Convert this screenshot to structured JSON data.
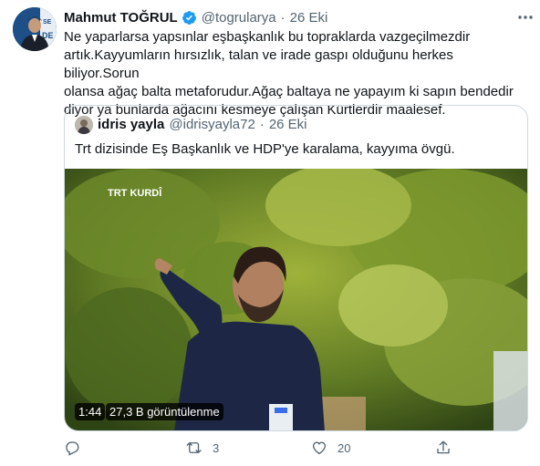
{
  "tweet": {
    "author_name": "Mahmut TOĞRUL",
    "author_handle": "@togrularya",
    "separator": "·",
    "date": "26 Eki",
    "text": "Ne yaparlarsa yapsınlar eşbaşkanlık bu topraklarda vazgeçilmezdir\nartık.Kayyumların hırsızlık, talan ve irade gaspı olduğunu herkes biliyor.Sorun\nolansa ağaç balta metaforudur.Ağaç baltaya ne yapayım ki sapın bendedir\ndiyor ya bunlarda ağacını kesmeye çalışan Kürtlerdir maalesef.",
    "verified_icon": "verified-badge-icon",
    "more_icon": "more-options-icon",
    "accent_color": "#1d9bf0"
  },
  "quoted_tweet": {
    "author_name": "idris yayla",
    "author_handle": "@idrisyayla72",
    "separator": "·",
    "date": "26 Eki",
    "text": "Trt dizisinde Eş Başkanlık ve HDP'ye karalama, kayyıma övgü.",
    "video": {
      "duration": "1:44",
      "views": "27,3 B görüntülenme",
      "channel_logo": "TRT KURDÎ"
    }
  },
  "actions": {
    "reply": {
      "icon": "reply-icon",
      "count": ""
    },
    "retweet": {
      "icon": "retweet-icon",
      "count": "3"
    },
    "like": {
      "icon": "heart-icon",
      "count": "20"
    },
    "share": {
      "icon": "share-icon",
      "count": ""
    }
  }
}
